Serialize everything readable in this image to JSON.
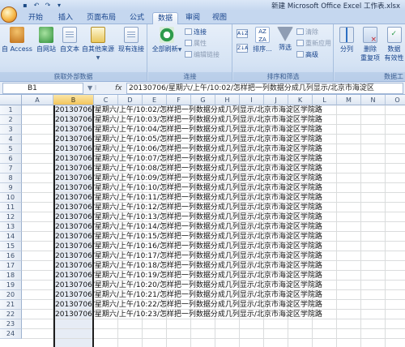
{
  "window": {
    "title": "新建 Microsoft Office Excel 工作表.xlsx"
  },
  "tabs": [
    {
      "label": "开始",
      "active": false
    },
    {
      "label": "插入",
      "active": false
    },
    {
      "label": "页面布局",
      "active": false
    },
    {
      "label": "公式",
      "active": false
    },
    {
      "label": "数据",
      "active": true
    },
    {
      "label": "审阅",
      "active": false
    },
    {
      "label": "视图",
      "active": false
    }
  ],
  "ribbon": {
    "external": {
      "label": "获取外部数据",
      "access": "自 Access",
      "web": "自网站",
      "text": "自文本",
      "other": "自其他来源",
      "existing": "现有连接"
    },
    "connections": {
      "label": "连接",
      "refresh": "全部刷新",
      "connections": "连接",
      "properties": "属性",
      "edit_links": "编辑链接"
    },
    "sort_filter": {
      "label": "排序和筛选",
      "sort_az": "A↓Z",
      "sort_za": "Z↓A",
      "sort": "排序...",
      "filter": "筛选",
      "clear": "清除",
      "reapply": "重新应用",
      "advanced": "高级"
    },
    "tools": {
      "label": "数据工",
      "text_to_columns": "分列",
      "remove_dup_1": "删除",
      "remove_dup_2": "重复项",
      "validation_1": "数据",
      "validation_2": "有效性"
    }
  },
  "formula_bar": {
    "name_box": "B1",
    "fx": "fx",
    "content": "20130706/星期六/上午/10:02/怎样把一列数据分成几列显示/北京市海淀区"
  },
  "columns": [
    "A",
    "B",
    "C",
    "D",
    "E",
    "F",
    "G",
    "H",
    "I",
    "J",
    "K",
    "L",
    "M",
    "N",
    "O"
  ],
  "selected_column": "B",
  "rows": [
    {
      "n": "1",
      "text": "20130706/星期六/上午/10:02/怎样把一列数据分成几列显示/北京市海淀区学院路"
    },
    {
      "n": "2",
      "text": "20130706/星期六/上午/10:03/怎样把一列数据分成几列显示/北京市海淀区学院路"
    },
    {
      "n": "3",
      "text": "20130706/星期六/上午/10:04/怎样把一列数据分成几列显示/北京市海淀区学院路"
    },
    {
      "n": "4",
      "text": "20130706/星期六/上午/10:05/怎样把一列数据分成几列显示/北京市海淀区学院路"
    },
    {
      "n": "5",
      "text": "20130706/星期六/上午/10:06/怎样把一列数据分成几列显示/北京市海淀区学院路"
    },
    {
      "n": "6",
      "text": "20130706/星期六/上午/10:07/怎样把一列数据分成几列显示/北京市海淀区学院路"
    },
    {
      "n": "7",
      "text": "20130706/星期六/上午/10:08/怎样把一列数据分成几列显示/北京市海淀区学院路"
    },
    {
      "n": "8",
      "text": "20130706/星期六/上午/10:09/怎样把一列数据分成几列显示/北京市海淀区学院路"
    },
    {
      "n": "9",
      "text": "20130706/星期六/上午/10:10/怎样把一列数据分成几列显示/北京市海淀区学院路"
    },
    {
      "n": "10",
      "text": "20130706/星期六/上午/10:11/怎样把一列数据分成几列显示/北京市海淀区学院路"
    },
    {
      "n": "11",
      "text": "20130706/星期六/上午/10:12/怎样把一列数据分成几列显示/北京市海淀区学院路"
    },
    {
      "n": "12",
      "text": "20130706/星期六/上午/10:13/怎样把一列数据分成几列显示/北京市海淀区学院路"
    },
    {
      "n": "13",
      "text": "20130706/星期六/上午/10:14/怎样把一列数据分成几列显示/北京市海淀区学院路"
    },
    {
      "n": "14",
      "text": "20130706/星期六/上午/10:15/怎样把一列数据分成几列显示/北京市海淀区学院路"
    },
    {
      "n": "15",
      "text": "20130706/星期六/上午/10:16/怎样把一列数据分成几列显示/北京市海淀区学院路"
    },
    {
      "n": "16",
      "text": "20130706/星期六/上午/10:17/怎样把一列数据分成几列显示/北京市海淀区学院路"
    },
    {
      "n": "17",
      "text": "20130706/星期六/上午/10:18/怎样把一列数据分成几列显示/北京市海淀区学院路"
    },
    {
      "n": "18",
      "text": "20130706/星期六/上午/10:19/怎样把一列数据分成几列显示/北京市海淀区学院路"
    },
    {
      "n": "19",
      "text": "20130706/星期六/上午/10:20/怎样把一列数据分成几列显示/北京市海淀区学院路"
    },
    {
      "n": "20",
      "text": "20130706/星期六/上午/10:21/怎样把一列数据分成几列显示/北京市海淀区学院路"
    },
    {
      "n": "21",
      "text": "20130706/星期六/上午/10:22/怎样把一列数据分成几列显示/北京市海淀区学院路"
    },
    {
      "n": "22",
      "text": "20130706/星期六/上午/10:23/怎样把一列数据分成几列显示/北京市海淀区学院路"
    },
    {
      "n": "23",
      "text": ""
    },
    {
      "n": "24",
      "text": ""
    }
  ],
  "colors": {
    "selection_border": "#1f1f1f",
    "selected_column_fill": "#e6ecf5",
    "selected_header": "#f3c55b",
    "ribbon": "#d5e3f4"
  }
}
